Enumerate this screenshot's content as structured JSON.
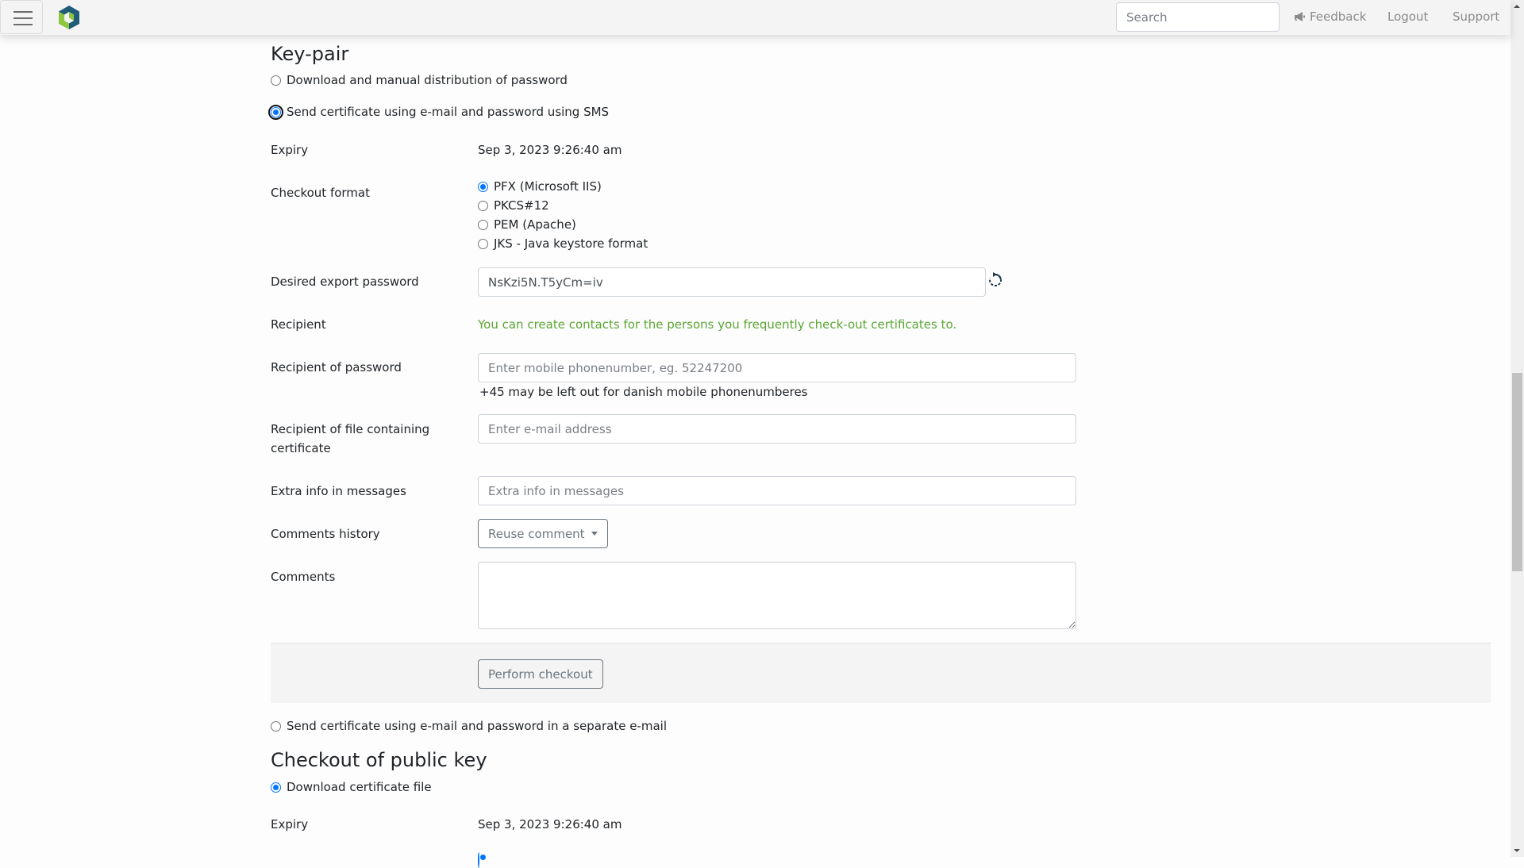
{
  "header": {
    "search_placeholder": "Search",
    "links": {
      "feedback": "Feedback",
      "logout": "Logout",
      "support": "Support"
    },
    "icons": {
      "menu": "hamburger-icon",
      "logo": "app-logo",
      "feedback": "megaphone-icon"
    }
  },
  "keypair": {
    "heading": "Key-pair",
    "delivery_options": [
      {
        "label": "Download and manual distribution of password",
        "checked": false
      },
      {
        "label": "Send certificate using e-mail and password using SMS",
        "checked": true
      }
    ],
    "expiry_label": "Expiry",
    "expiry_value": "Sep 3, 2023 9:26:40 am",
    "format_label": "Checkout format",
    "formats": [
      {
        "label": "PFX (Microsoft IIS)",
        "checked": true
      },
      {
        "label": "PKCS#12",
        "checked": false
      },
      {
        "label": "PEM (Apache)",
        "checked": false
      },
      {
        "label": "JKS - Java keystore format",
        "checked": false
      }
    ],
    "password_label": "Desired export password",
    "password_value": "NsKzi5N.T5yCm=iv",
    "recipient_label": "Recipient",
    "recipient_hint": "You can create contacts for the persons you frequently check-out certificates to.",
    "recipient_password_label": "Recipient of password",
    "recipient_password_placeholder": "Enter mobile phonenumber, eg. 52247200",
    "recipient_password_help": "+45 may be left out for danish mobile phonenumberes",
    "recipient_file_label": "Recipient of file containing certificate",
    "recipient_file_placeholder": "Enter e-mail address",
    "extra_info_label": "Extra info in messages",
    "extra_info_placeholder": "Extra info in messages",
    "comments_history_label": "Comments history",
    "reuse_comment_label": "Reuse comment",
    "comments_label": "Comments",
    "comments_value": "",
    "perform_label": "Perform checkout",
    "separate_email_option": {
      "label": "Send certificate using e-mail and password in a separate e-mail",
      "checked": false
    }
  },
  "public_key": {
    "heading": "Checkout of public key",
    "download_option": {
      "label": "Download certificate file",
      "checked": true
    },
    "expiry_label": "Expiry",
    "expiry_value": "Sep 3, 2023 9:26:40 am"
  },
  "colors": {
    "accent": "#0075ff",
    "hint_green": "#5ba632",
    "header_bg": "#f4f4f4",
    "panel_bg": "#f4f4f4",
    "logo_green": "#8dc63f",
    "logo_teal": "#1f5c78"
  }
}
